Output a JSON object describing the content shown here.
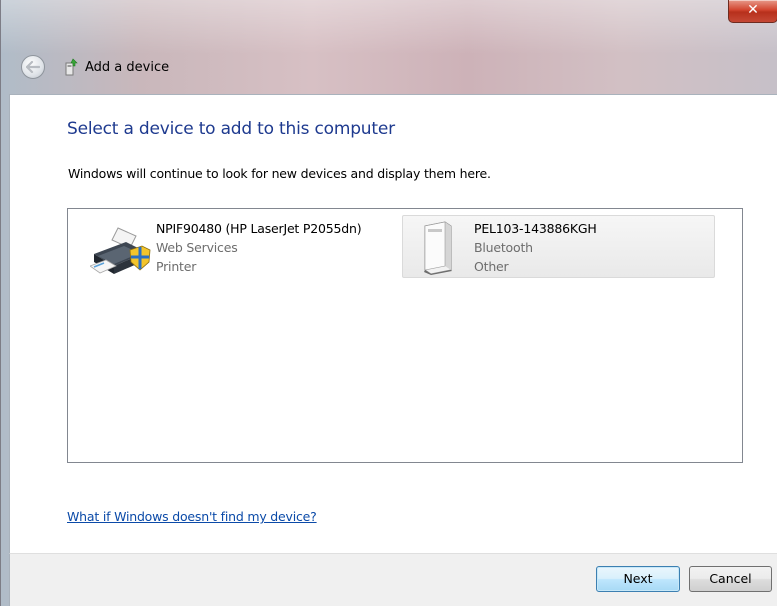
{
  "window": {
    "close_glyph": "✕"
  },
  "nav": {
    "title": "Add a device",
    "back_icon": "back-arrow-icon"
  },
  "main": {
    "heading": "Select a device to add to this computer",
    "description": "Windows will continue to look for new devices and display them here.",
    "devices": [
      {
        "name": "NPIF90480 (HP LaserJet P2055dn)",
        "connection": "Web Services",
        "category": "Printer",
        "icon": "printer-icon"
      },
      {
        "name": "PEL103-143886KGH",
        "connection": "Bluetooth",
        "category": "Other",
        "icon": "generic-device-icon"
      }
    ],
    "help_link": "What if Windows doesn't find my device?"
  },
  "footer": {
    "next_label": "Next",
    "cancel_label": "Cancel"
  },
  "colors": {
    "heading": "#1e3a8f",
    "link": "#0b4aa8",
    "close_button": "#c9412c"
  }
}
